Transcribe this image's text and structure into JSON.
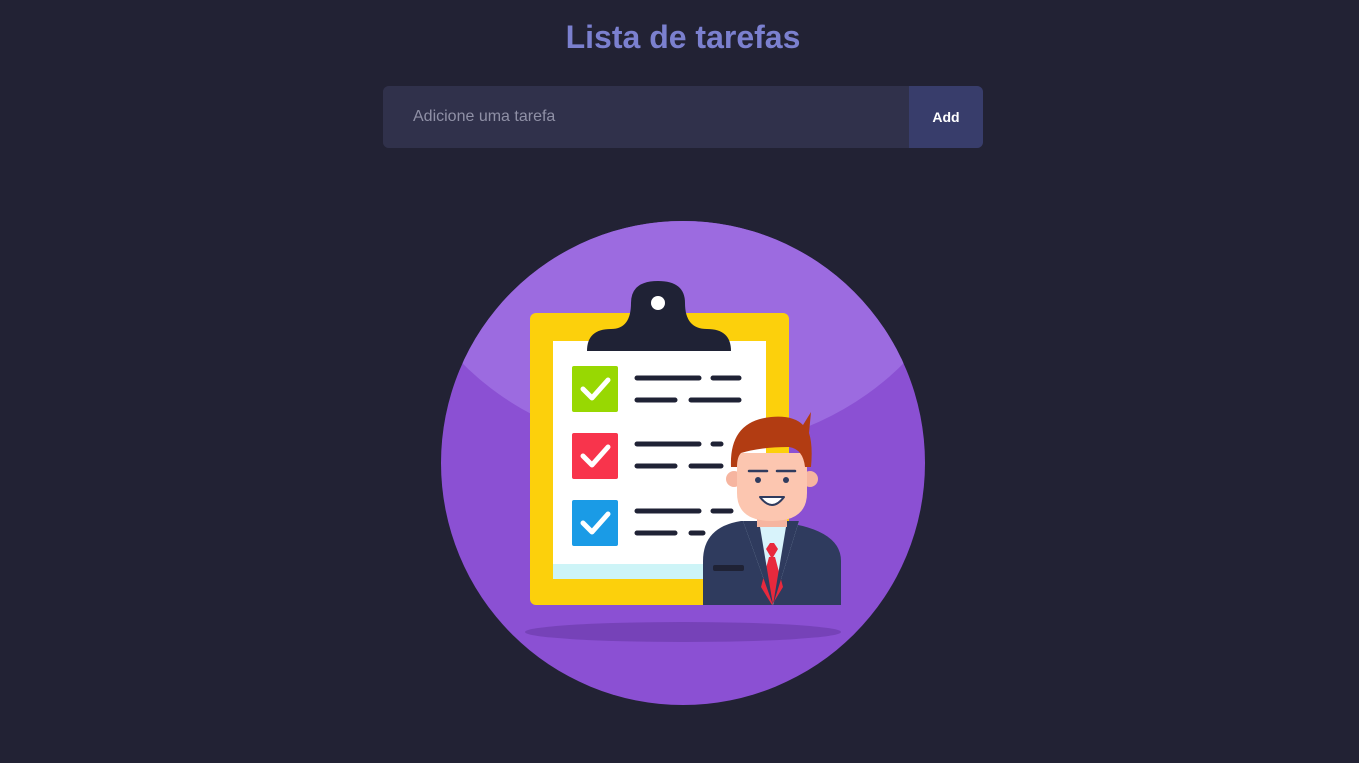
{
  "header": {
    "title": "Lista de tarefas"
  },
  "form": {
    "input_placeholder": "Adicione uma tarefa",
    "input_value": "",
    "add_label": "Add"
  },
  "colors": {
    "background": "#222234",
    "title": "#7b80cf",
    "input_background": "#30314b",
    "button_background": "#383d6b",
    "circle": "#8b50d3",
    "clipboard": "#fcd00c",
    "check_green": "#98d802",
    "check_red": "#f8344c",
    "check_blue": "#1a9be6"
  },
  "illustration": {
    "icon": "checklist-person-illustration"
  }
}
